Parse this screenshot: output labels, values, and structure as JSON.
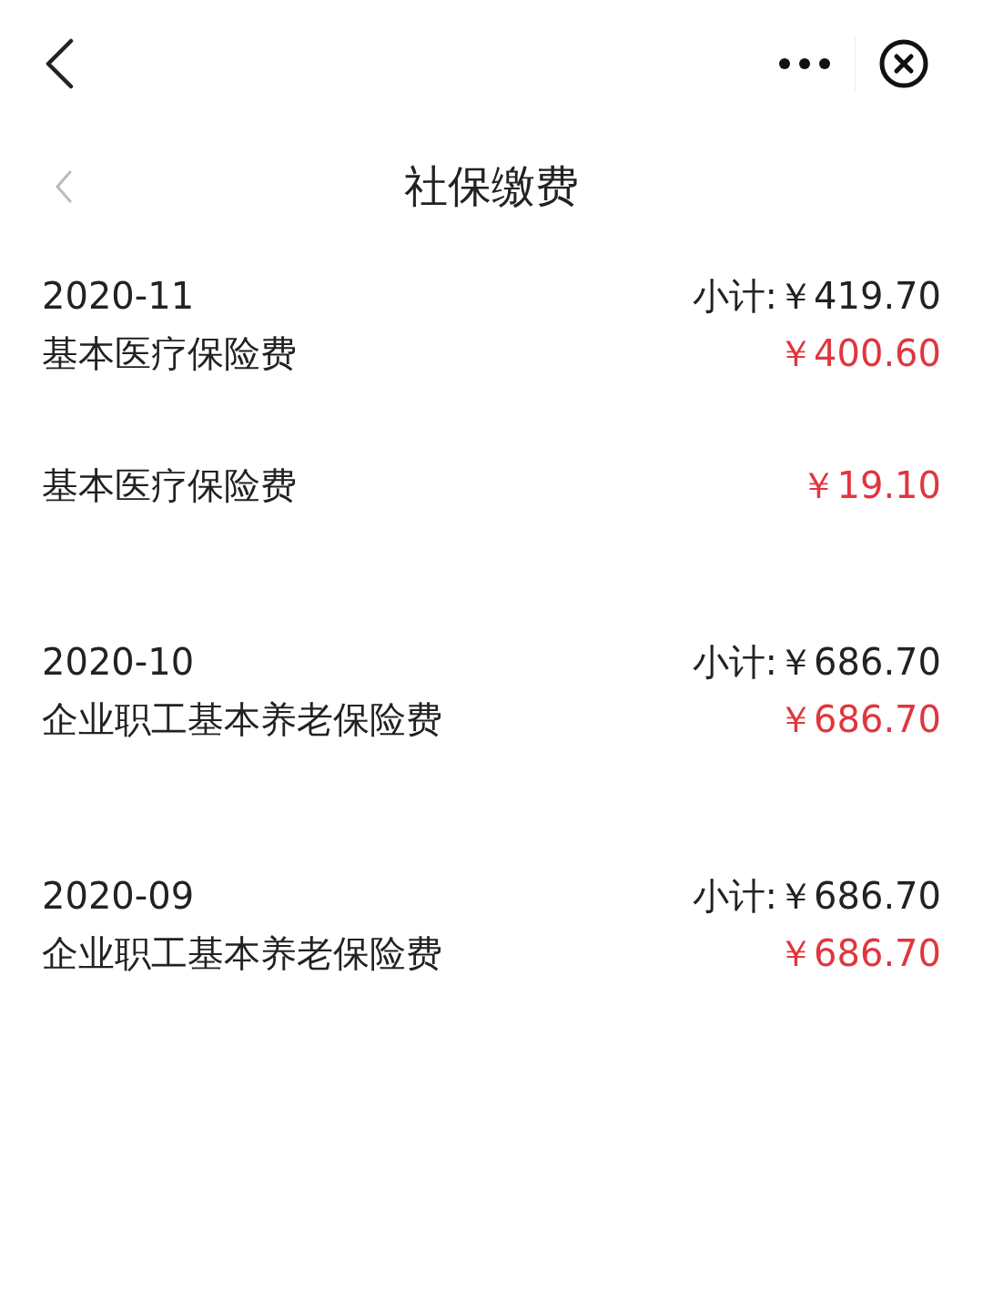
{
  "page": {
    "title": "社保缴费"
  },
  "groups": [
    {
      "month": "2020-11",
      "subtotal": "小计:￥419.70",
      "items": [
        {
          "name": "基本医疗保险费",
          "amount": "￥400.60"
        },
        {
          "name": "基本医疗保险费",
          "amount": "￥19.10"
        }
      ]
    },
    {
      "month": "2020-10",
      "subtotal": "小计:￥686.70",
      "items": [
        {
          "name": "企业职工基本养老保险费",
          "amount": "￥686.70"
        }
      ]
    },
    {
      "month": "2020-09",
      "subtotal": "小计:￥686.70",
      "items": [
        {
          "name": "企业职工基本养老保险费",
          "amount": "￥686.70"
        }
      ]
    }
  ]
}
